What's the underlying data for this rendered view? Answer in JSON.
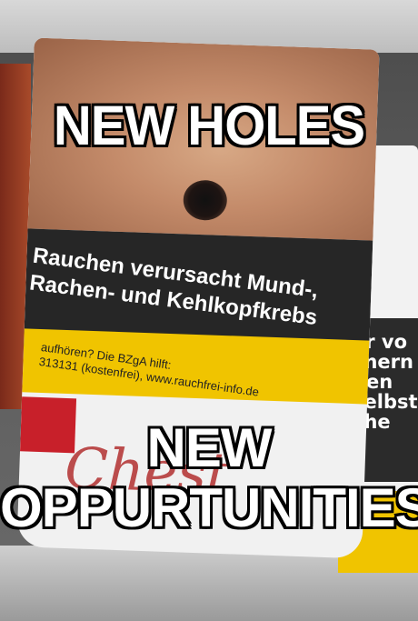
{
  "meme": {
    "top_text": "NEW HOLES",
    "bottom_text_line1": "NEW",
    "bottom_text_line2": "OPPURTUNITIES"
  },
  "package": {
    "warning_line1": "Rauchen verursacht Mund-,",
    "warning_line2": "Rachen- und Kehlkopfkrebs",
    "help_line1": "aufhören? Die BZgA hilft:",
    "help_line2": "313131 (kostenfrei), www.rauchfrei-info.de",
    "brand_partial": "Chest",
    "right_pack_text": "er vo\nchern\nden\nselbst z\nche"
  },
  "colors": {
    "caption_fill": "#ffffff",
    "caption_stroke": "#000000",
    "warning_band": "#262626",
    "help_band": "#f0c400"
  }
}
